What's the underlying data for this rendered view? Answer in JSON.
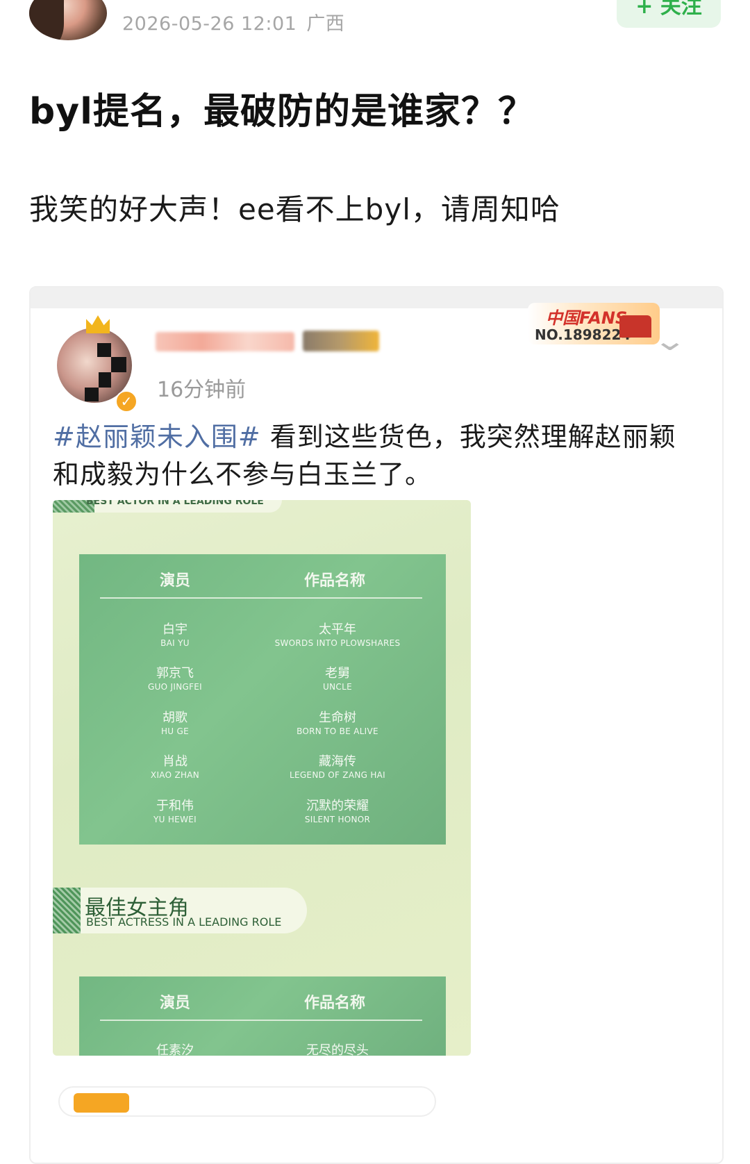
{
  "post": {
    "timestamp": "2026-05-26 12:01",
    "location": "广西",
    "follow_label": "+ 关注",
    "title": "byl提名，最破防的是谁家？？",
    "body": "我笑的好大声！ee看不上byl，请周知哈"
  },
  "quoted_post": {
    "time_ago": "16分钟前",
    "fans_badge": {
      "brand": "中国FANS",
      "number": "NO.1898224"
    },
    "hashtag": "#赵丽颖未入围#",
    "text": " 看到这些货色，我突然理解赵丽颖和成毅为什么不参与白玉兰了。",
    "poster": {
      "banner1_en": "BEST ACTOR IN A LEADING ROLE",
      "table1": {
        "headers": [
          "演员",
          "作品名称"
        ],
        "rows": [
          {
            "actor_cn": "白宇",
            "actor_en": "BAI YU",
            "work_cn": "太平年",
            "work_en": "SWORDS INTO PLOWSHARES"
          },
          {
            "actor_cn": "郭京飞",
            "actor_en": "GUO JINGFEI",
            "work_cn": "老舅",
            "work_en": "UNCLE"
          },
          {
            "actor_cn": "胡歌",
            "actor_en": "HU GE",
            "work_cn": "生命树",
            "work_en": "BORN TO BE ALIVE"
          },
          {
            "actor_cn": "肖战",
            "actor_en": "XIAO ZHAN",
            "work_cn": "藏海传",
            "work_en": "LEGEND OF ZANG HAI"
          },
          {
            "actor_cn": "于和伟",
            "actor_en": "YU HEWEI",
            "work_cn": "沉默的荣耀",
            "work_en": "SILENT HONOR"
          }
        ]
      },
      "banner2_cn": "最佳女主角",
      "banner2_en": "BEST ACTRESS IN A LEADING ROLE",
      "table2": {
        "headers": [
          "演员",
          "作品名称"
        ],
        "rows": [
          {
            "actor_cn": "任素汐",
            "work_cn": "无尽的尽头"
          }
        ]
      }
    }
  }
}
